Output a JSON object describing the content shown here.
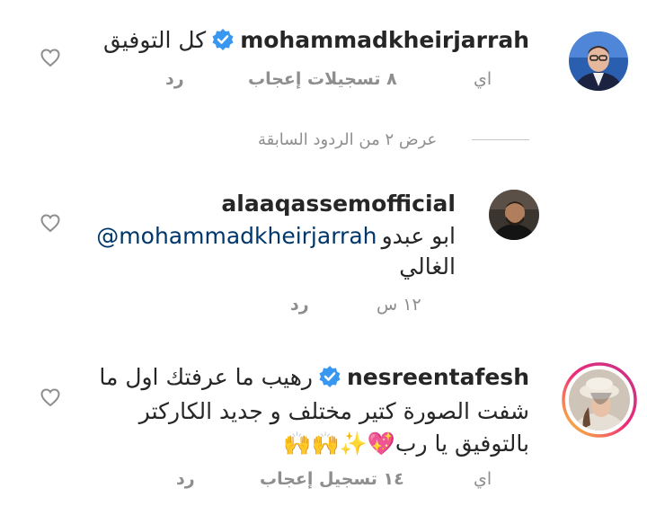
{
  "comments": [
    {
      "username": "mohammadkheirjarrah",
      "verified": true,
      "text": "كل التوفيق",
      "time": "اي",
      "likes": "٨ تسجيلات إعجاب",
      "reply": "رد"
    },
    {
      "username": "alaaqassemofficial",
      "verified": false,
      "text_prefix": "ابو عبدو",
      "mention": "@mohammadkheirjarrah",
      "text_line2": "الغالي",
      "time": "١٢ س",
      "reply": "رد"
    },
    {
      "username": "nesreentafesh",
      "verified": true,
      "line1": "رهيب ما عرفتك اول ما",
      "line2": "شفت الصورة كتير مختلف و جديد الكاركتر",
      "line3": "بالتوفيق يا رب💖✨🙌🙌",
      "time": "اي",
      "likes": "١٤ تسجيل إعجاب",
      "reply": "رد"
    }
  ],
  "view_replies": "عرض ٢ من الردود السابقة",
  "colors": {
    "text": "#262626",
    "meta": "#8e8e8e",
    "mention": "#00376b",
    "verified": "#3897f0",
    "story_ring_start": "#f9ce34",
    "story_ring_end": "#c13584"
  },
  "icons": [
    "heart-icon",
    "verified-badge-icon"
  ]
}
